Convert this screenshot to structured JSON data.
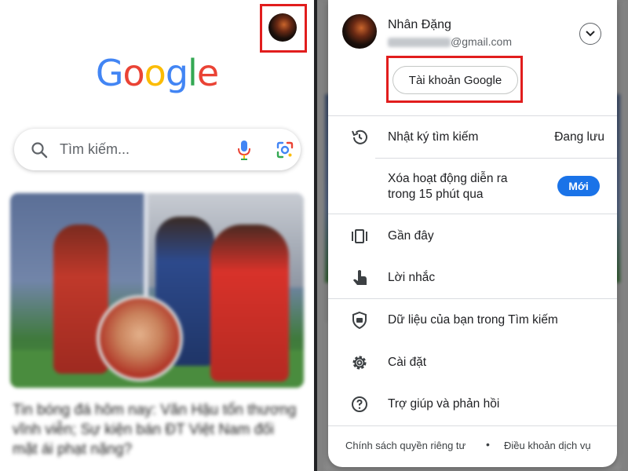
{
  "left": {
    "logo": [
      "G",
      "o",
      "o",
      "g",
      "l",
      "e"
    ],
    "search": {
      "placeholder": "Tìm kiếm..."
    },
    "news_title": "Tin bóng đá hôm nay: Văn Hậu tổn thương vĩnh viễn; Sự kiện bán ĐT Việt Nam đối mặt ái phạt nặng?"
  },
  "account": {
    "name": "Nhân Đặng",
    "email_suffix": "@gmail.com",
    "manage_button": "Tài khoản Google"
  },
  "menu": {
    "history_label": "Nhật ký tìm kiếm",
    "history_status": "Đang lưu",
    "delete_label_line1": "Xóa hoạt động diễn ra",
    "delete_label_line2": "trong 15 phút qua",
    "delete_badge": "Mới",
    "recent_label": "Gần đây",
    "reminders_label": "Lời nhắc",
    "data_label": "Dữ liệu của bạn trong Tìm kiếm",
    "settings_label": "Cài đặt",
    "help_label": "Trợ giúp và phản hồi"
  },
  "footer": {
    "privacy": "Chính sách quyền riêng tư",
    "separator": "•",
    "terms": "Điều khoản dịch vụ"
  },
  "colors": {
    "highlight": "#e11d1d",
    "badge": "#1a73e8",
    "google_blue": "#4285f4",
    "google_red": "#ea4335",
    "google_yellow": "#fbbc05",
    "google_green": "#34a853"
  }
}
